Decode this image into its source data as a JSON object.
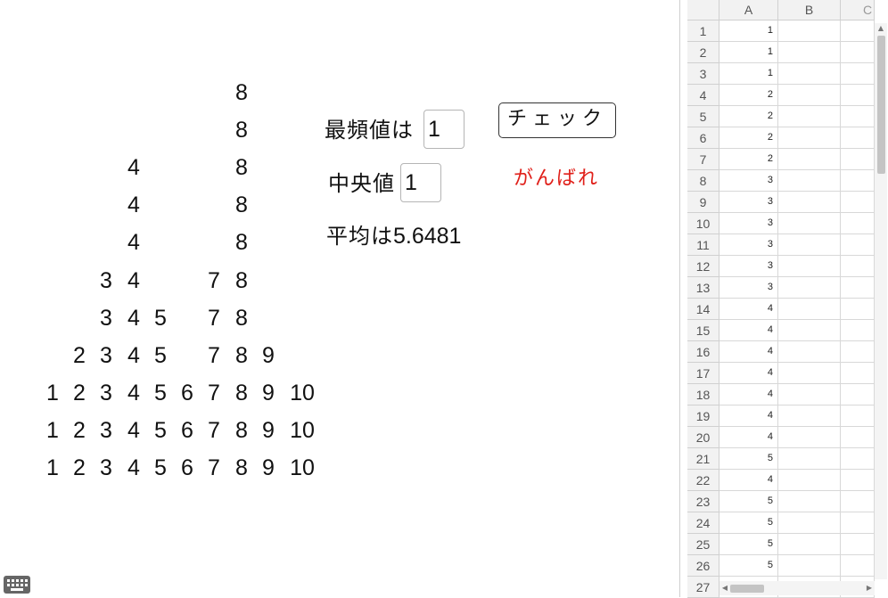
{
  "dot_plot": {
    "columns": [
      {
        "label": "1",
        "count": 3
      },
      {
        "label": "2",
        "count": 4
      },
      {
        "label": "3",
        "count": 6
      },
      {
        "label": "4",
        "count": 9
      },
      {
        "label": "5",
        "count": 5
      },
      {
        "label": "6",
        "count": 3
      },
      {
        "label": "7",
        "count": 6
      },
      {
        "label": "8",
        "count": 11
      },
      {
        "label": "9",
        "count": 4
      },
      {
        "label": "10",
        "count": 3
      }
    ]
  },
  "labels": {
    "mode_label": "最頻値は",
    "mode_value": "1",
    "median_label": "中央値",
    "median_value": "1",
    "mean_label": "平均は",
    "mean_value": "5.6481"
  },
  "check_button": "チェック",
  "feedback": "がんばれ",
  "spreadsheet": {
    "columns": [
      "A",
      "B",
      "C"
    ],
    "rows": [
      {
        "row": "1",
        "a": "1"
      },
      {
        "row": "2",
        "a": "1"
      },
      {
        "row": "3",
        "a": "1"
      },
      {
        "row": "4",
        "a": "2"
      },
      {
        "row": "5",
        "a": "2"
      },
      {
        "row": "6",
        "a": "2"
      },
      {
        "row": "7",
        "a": "2"
      },
      {
        "row": "8",
        "a": "3"
      },
      {
        "row": "9",
        "a": "3"
      },
      {
        "row": "10",
        "a": "3"
      },
      {
        "row": "11",
        "a": "3"
      },
      {
        "row": "12",
        "a": "3"
      },
      {
        "row": "13",
        "a": "3"
      },
      {
        "row": "14",
        "a": "4"
      },
      {
        "row": "15",
        "a": "4"
      },
      {
        "row": "16",
        "a": "4"
      },
      {
        "row": "17",
        "a": "4"
      },
      {
        "row": "18",
        "a": "4"
      },
      {
        "row": "19",
        "a": "4"
      },
      {
        "row": "20",
        "a": "4"
      },
      {
        "row": "21",
        "a": "5"
      },
      {
        "row": "22",
        "a": "4"
      },
      {
        "row": "23",
        "a": "5"
      },
      {
        "row": "24",
        "a": "5"
      },
      {
        "row": "25",
        "a": "5"
      },
      {
        "row": "26",
        "a": "5"
      },
      {
        "row": "27",
        "a": ""
      }
    ]
  },
  "icons": {
    "keyboard": "keyboard-icon",
    "scroll_up": "chevron-up-icon",
    "scroll_left": "chevron-left-icon",
    "scroll_right": "chevron-right-icon"
  }
}
